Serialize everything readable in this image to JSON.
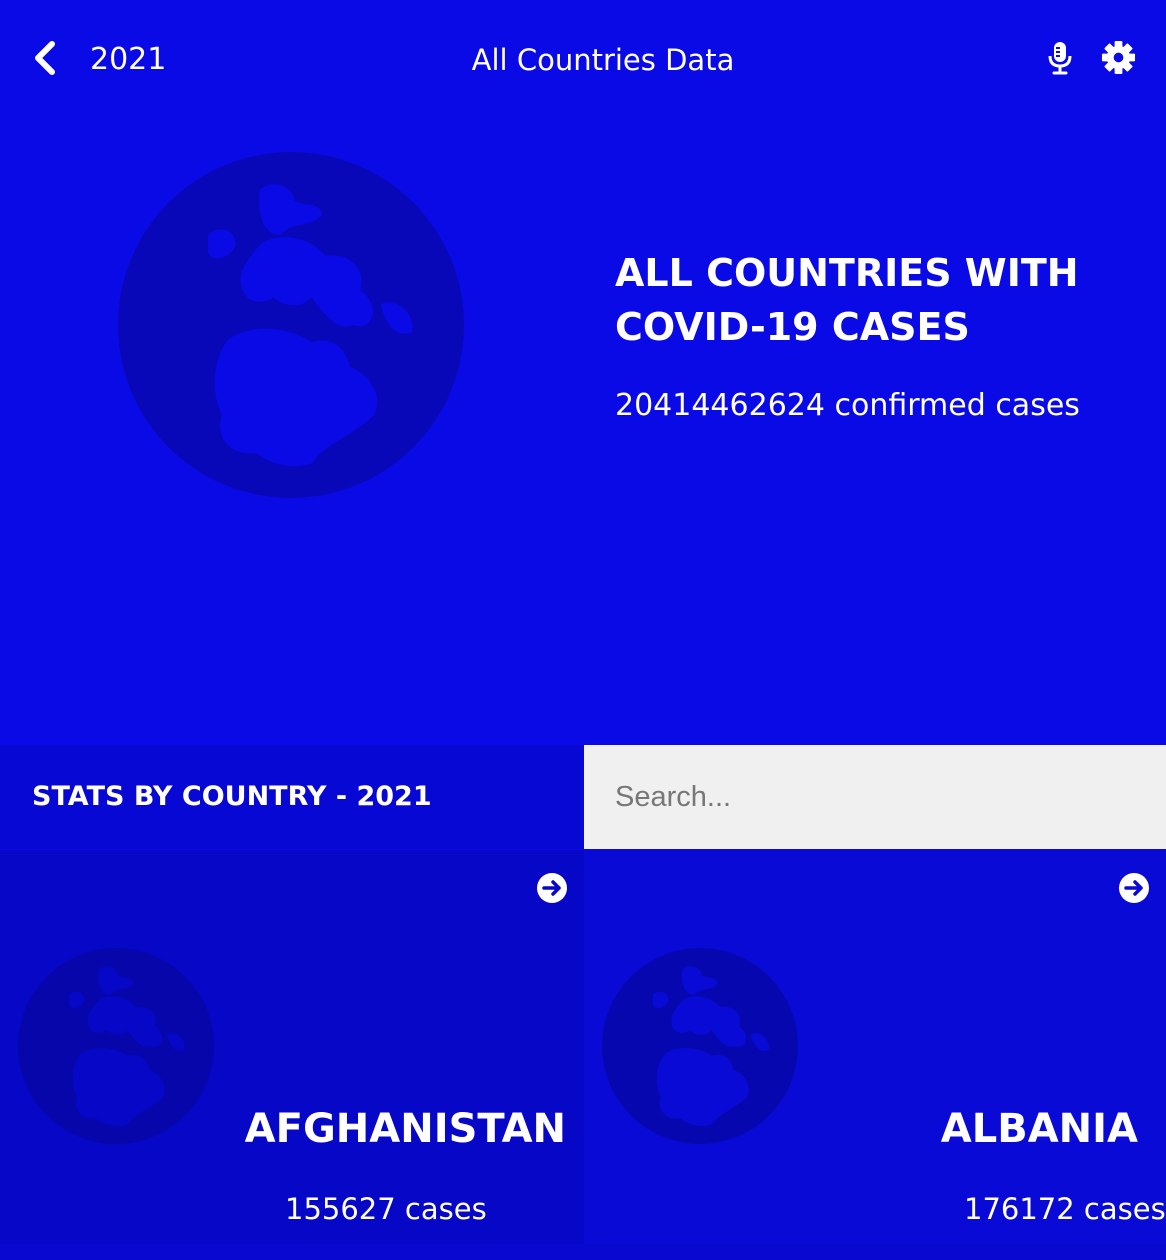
{
  "header": {
    "back_icon": "chevron-left-icon",
    "year": "2021",
    "title": "All Countries Data",
    "mic_icon": "microphone-icon",
    "settings_icon": "gear-icon"
  },
  "hero": {
    "icon": "globe-europe-icon",
    "heading": "ALL COUNTRIES WITH COVID-19 CASES",
    "cases": "20414462624 confirmed cases"
  },
  "stats": {
    "label": "STATS BY COUNTRY - 2021"
  },
  "search": {
    "placeholder": "Search..."
  },
  "countries": [
    {
      "name": "AFGHANISTAN",
      "cases": "155627 cases",
      "icon": "arrow-circle-right-icon"
    },
    {
      "name": "ALBANIA",
      "cases": "176172 cases",
      "icon": "arrow-circle-right-icon"
    }
  ],
  "colors": {
    "background": "#0a0ae6",
    "stats_bar": "#0808d4",
    "search_bg": "#f0f0f0",
    "card_dark": "#0707c8",
    "card_light": "#0a0ad6",
    "globe_shade": "#0808b8"
  }
}
